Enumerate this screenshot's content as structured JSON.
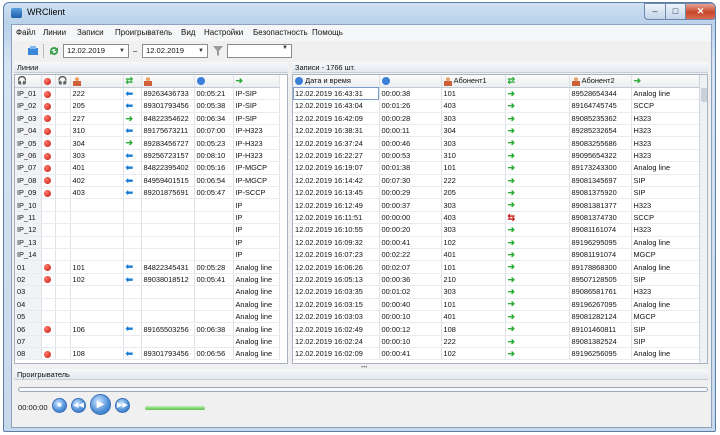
{
  "window": {
    "title": "WRClient",
    "min": "–",
    "max": "□",
    "close": "✕"
  },
  "menu": [
    "Файл",
    "Линии",
    "Записи",
    "Проигрыватель",
    "Вид",
    "Настройки",
    "Безопастность",
    "Помощь"
  ],
  "toolbar": {
    "date_from": "12.02.2019",
    "date_sep": "–",
    "date_to": "12.02.2019",
    "filter_value": ""
  },
  "colors": {
    "incoming_arrow": "#1a7cd6",
    "outgoing_arrow": "#2fae3a",
    "missed_arrow": "#c21818",
    "active_dot": "#c0140a"
  },
  "lines_panel": {
    "title": "Линии",
    "rows": [
      {
        "line": "IP_01",
        "active": true,
        "number": "222",
        "dir": "in",
        "phone": "89263436733",
        "duration": "00:05:21",
        "type": "IP-SIP"
      },
      {
        "line": "IP_02",
        "active": true,
        "number": "205",
        "dir": "in",
        "phone": "89301793456",
        "duration": "00:05:38",
        "type": "IP-SIP"
      },
      {
        "line": "IP_03",
        "active": true,
        "number": "227",
        "dir": "out",
        "phone": "84822354622",
        "duration": "00:06:34",
        "type": "IP-SIP"
      },
      {
        "line": "IP_04",
        "active": true,
        "number": "310",
        "dir": "in",
        "phone": "89175673211",
        "duration": "00:07:00",
        "type": "IP-H323"
      },
      {
        "line": "IP_05",
        "active": true,
        "number": "304",
        "dir": "out",
        "phone": "89283456727",
        "duration": "00:05:23",
        "type": "IP-H323"
      },
      {
        "line": "IP_06",
        "active": true,
        "number": "303",
        "dir": "in",
        "phone": "89256723157",
        "duration": "00:08:10",
        "type": "IP-H323"
      },
      {
        "line": "IP_07",
        "active": true,
        "number": "401",
        "dir": "in",
        "phone": "84822395402",
        "duration": "00:05:16",
        "type": "IP-MGCP"
      },
      {
        "line": "IP_08",
        "active": true,
        "number": "402",
        "dir": "in",
        "phone": "84959401515",
        "duration": "00:06:54",
        "type": "IP-MGCP"
      },
      {
        "line": "IP_09",
        "active": true,
        "number": "403",
        "dir": "in",
        "phone": "89201875691",
        "duration": "00:05:47",
        "type": "IP-SCCP"
      },
      {
        "line": "IP_10",
        "active": false,
        "number": "",
        "dir": "",
        "phone": "",
        "duration": "",
        "type": "IP"
      },
      {
        "line": "IP_11",
        "active": false,
        "number": "",
        "dir": "",
        "phone": "",
        "duration": "",
        "type": "IP"
      },
      {
        "line": "IP_12",
        "active": false,
        "number": "",
        "dir": "",
        "phone": "",
        "duration": "",
        "type": "IP"
      },
      {
        "line": "IP_13",
        "active": false,
        "number": "",
        "dir": "",
        "phone": "",
        "duration": "",
        "type": "IP"
      },
      {
        "line": "IP_14",
        "active": false,
        "number": "",
        "dir": "",
        "phone": "",
        "duration": "",
        "type": "IP"
      },
      {
        "line": "01",
        "active": true,
        "number": "101",
        "dir": "in",
        "phone": "84822345431",
        "duration": "00:05:28",
        "type": "Analog line"
      },
      {
        "line": "02",
        "active": true,
        "number": "102",
        "dir": "in",
        "phone": "89038018512",
        "duration": "00:05:41",
        "type": "Analog line"
      },
      {
        "line": "03",
        "active": false,
        "number": "",
        "dir": "",
        "phone": "",
        "duration": "",
        "type": "Analog line"
      },
      {
        "line": "04",
        "active": false,
        "number": "",
        "dir": "",
        "phone": "",
        "duration": "",
        "type": "Analog line"
      },
      {
        "line": "05",
        "active": false,
        "number": "",
        "dir": "",
        "phone": "",
        "duration": "",
        "type": "Analog line"
      },
      {
        "line": "06",
        "active": true,
        "number": "106",
        "dir": "in",
        "phone": "89165503256",
        "duration": "00:06:38",
        "type": "Analog line"
      },
      {
        "line": "07",
        "active": false,
        "number": "",
        "dir": "",
        "phone": "",
        "duration": "",
        "type": "Analog line"
      },
      {
        "line": "08",
        "active": true,
        "number": "108",
        "dir": "in",
        "phone": "89301793456",
        "duration": "00:06:56",
        "type": "Analog line"
      }
    ]
  },
  "records_panel": {
    "title": "Записи - 1766 шт.",
    "headers": {
      "datetime": "Дата и время",
      "abonent1": "Абонент1",
      "abonent2": "Абонент2"
    },
    "rows": [
      {
        "dt": "12.02.2019 16:43:31",
        "dur": "00:00:38",
        "a1": "101",
        "dir": "out",
        "a2": "89528654344",
        "type": "Analog line"
      },
      {
        "dt": "12.02.2019 16:43:04",
        "dur": "00:01:26",
        "a1": "403",
        "dir": "out",
        "a2": "89164745745",
        "type": "SCCP"
      },
      {
        "dt": "12.02.2019 16:42:09",
        "dur": "00:00:28",
        "a1": "303",
        "dir": "out",
        "a2": "89085235362",
        "type": "H323"
      },
      {
        "dt": "12.02.2019 16:38:31",
        "dur": "00:00:11",
        "a1": "304",
        "dir": "out",
        "a2": "89285232654",
        "type": "H323"
      },
      {
        "dt": "12.02.2019 16:37:24",
        "dur": "00:00:46",
        "a1": "303",
        "dir": "out",
        "a2": "89083255686",
        "type": "H323"
      },
      {
        "dt": "12.02.2019 16:22:27",
        "dur": "00:00:53",
        "a1": "310",
        "dir": "out",
        "a2": "89095654322",
        "type": "H323"
      },
      {
        "dt": "12.02.2019 16:19:07",
        "dur": "00:01:38",
        "a1": "101",
        "dir": "out",
        "a2": "89173243300",
        "type": "Analog line"
      },
      {
        "dt": "12.02.2019 16:14:42",
        "dur": "00:07:30",
        "a1": "222",
        "dir": "out",
        "a2": "89081345697",
        "type": "SIP"
      },
      {
        "dt": "12.02.2019 16:13:45",
        "dur": "00:00:29",
        "a1": "205",
        "dir": "out",
        "a2": "89081375920",
        "type": "SIP"
      },
      {
        "dt": "12.02.2019 16:12:49",
        "dur": "00:00:37",
        "a1": "303",
        "dir": "out",
        "a2": "89081381377",
        "type": "H323"
      },
      {
        "dt": "12.02.2019 16:11:51",
        "dur": "00:00:00",
        "a1": "403",
        "dir": "missed",
        "a2": "89081374730",
        "type": "SCCP"
      },
      {
        "dt": "12.02.2019 16:10:55",
        "dur": "00:00:20",
        "a1": "303",
        "dir": "out",
        "a2": "89081161074",
        "type": "H323"
      },
      {
        "dt": "12.02.2019 16:09:32",
        "dur": "00:00:41",
        "a1": "102",
        "dir": "out",
        "a2": "89196295095",
        "type": "Analog line"
      },
      {
        "dt": "12.02.2019 16:07:23",
        "dur": "00:02:22",
        "a1": "401",
        "dir": "out",
        "a2": "89081191074",
        "type": "MGCP"
      },
      {
        "dt": "12.02.2019 16:06:26",
        "dur": "00:02:07",
        "a1": "101",
        "dir": "out",
        "a2": "89178868300",
        "type": "Analog line"
      },
      {
        "dt": "12.02.2019 16:05:13",
        "dur": "00:00:36",
        "a1": "210",
        "dir": "out",
        "a2": "89507128505",
        "type": "SIP"
      },
      {
        "dt": "12.02.2019 16:03:35",
        "dur": "00:01:02",
        "a1": "303",
        "dir": "out",
        "a2": "89086581761",
        "type": "H323"
      },
      {
        "dt": "12.02.2019 16:03:15",
        "dur": "00:00:40",
        "a1": "101",
        "dir": "out",
        "a2": "89196267095",
        "type": "Analog line"
      },
      {
        "dt": "12.02.2019 16:03:03",
        "dur": "00:00:10",
        "a1": "401",
        "dir": "out",
        "a2": "89081282124",
        "type": "MGCP"
      },
      {
        "dt": "12.02.2019 16:02:49",
        "dur": "00:00:12",
        "a1": "108",
        "dir": "out",
        "a2": "89101460811",
        "type": "SIP"
      },
      {
        "dt": "12.02.2019 16:02:24",
        "dur": "00:00:10",
        "a1": "222",
        "dir": "out",
        "a2": "89081382524",
        "type": "SIP"
      },
      {
        "dt": "12.02.2019 16:02:09",
        "dur": "00:00:41",
        "a1": "102",
        "dir": "out",
        "a2": "89196256095",
        "type": "Analog line"
      }
    ]
  },
  "player": {
    "title": "Проигрыватель",
    "time": "00:00:00",
    "volume_level": 1.0
  }
}
